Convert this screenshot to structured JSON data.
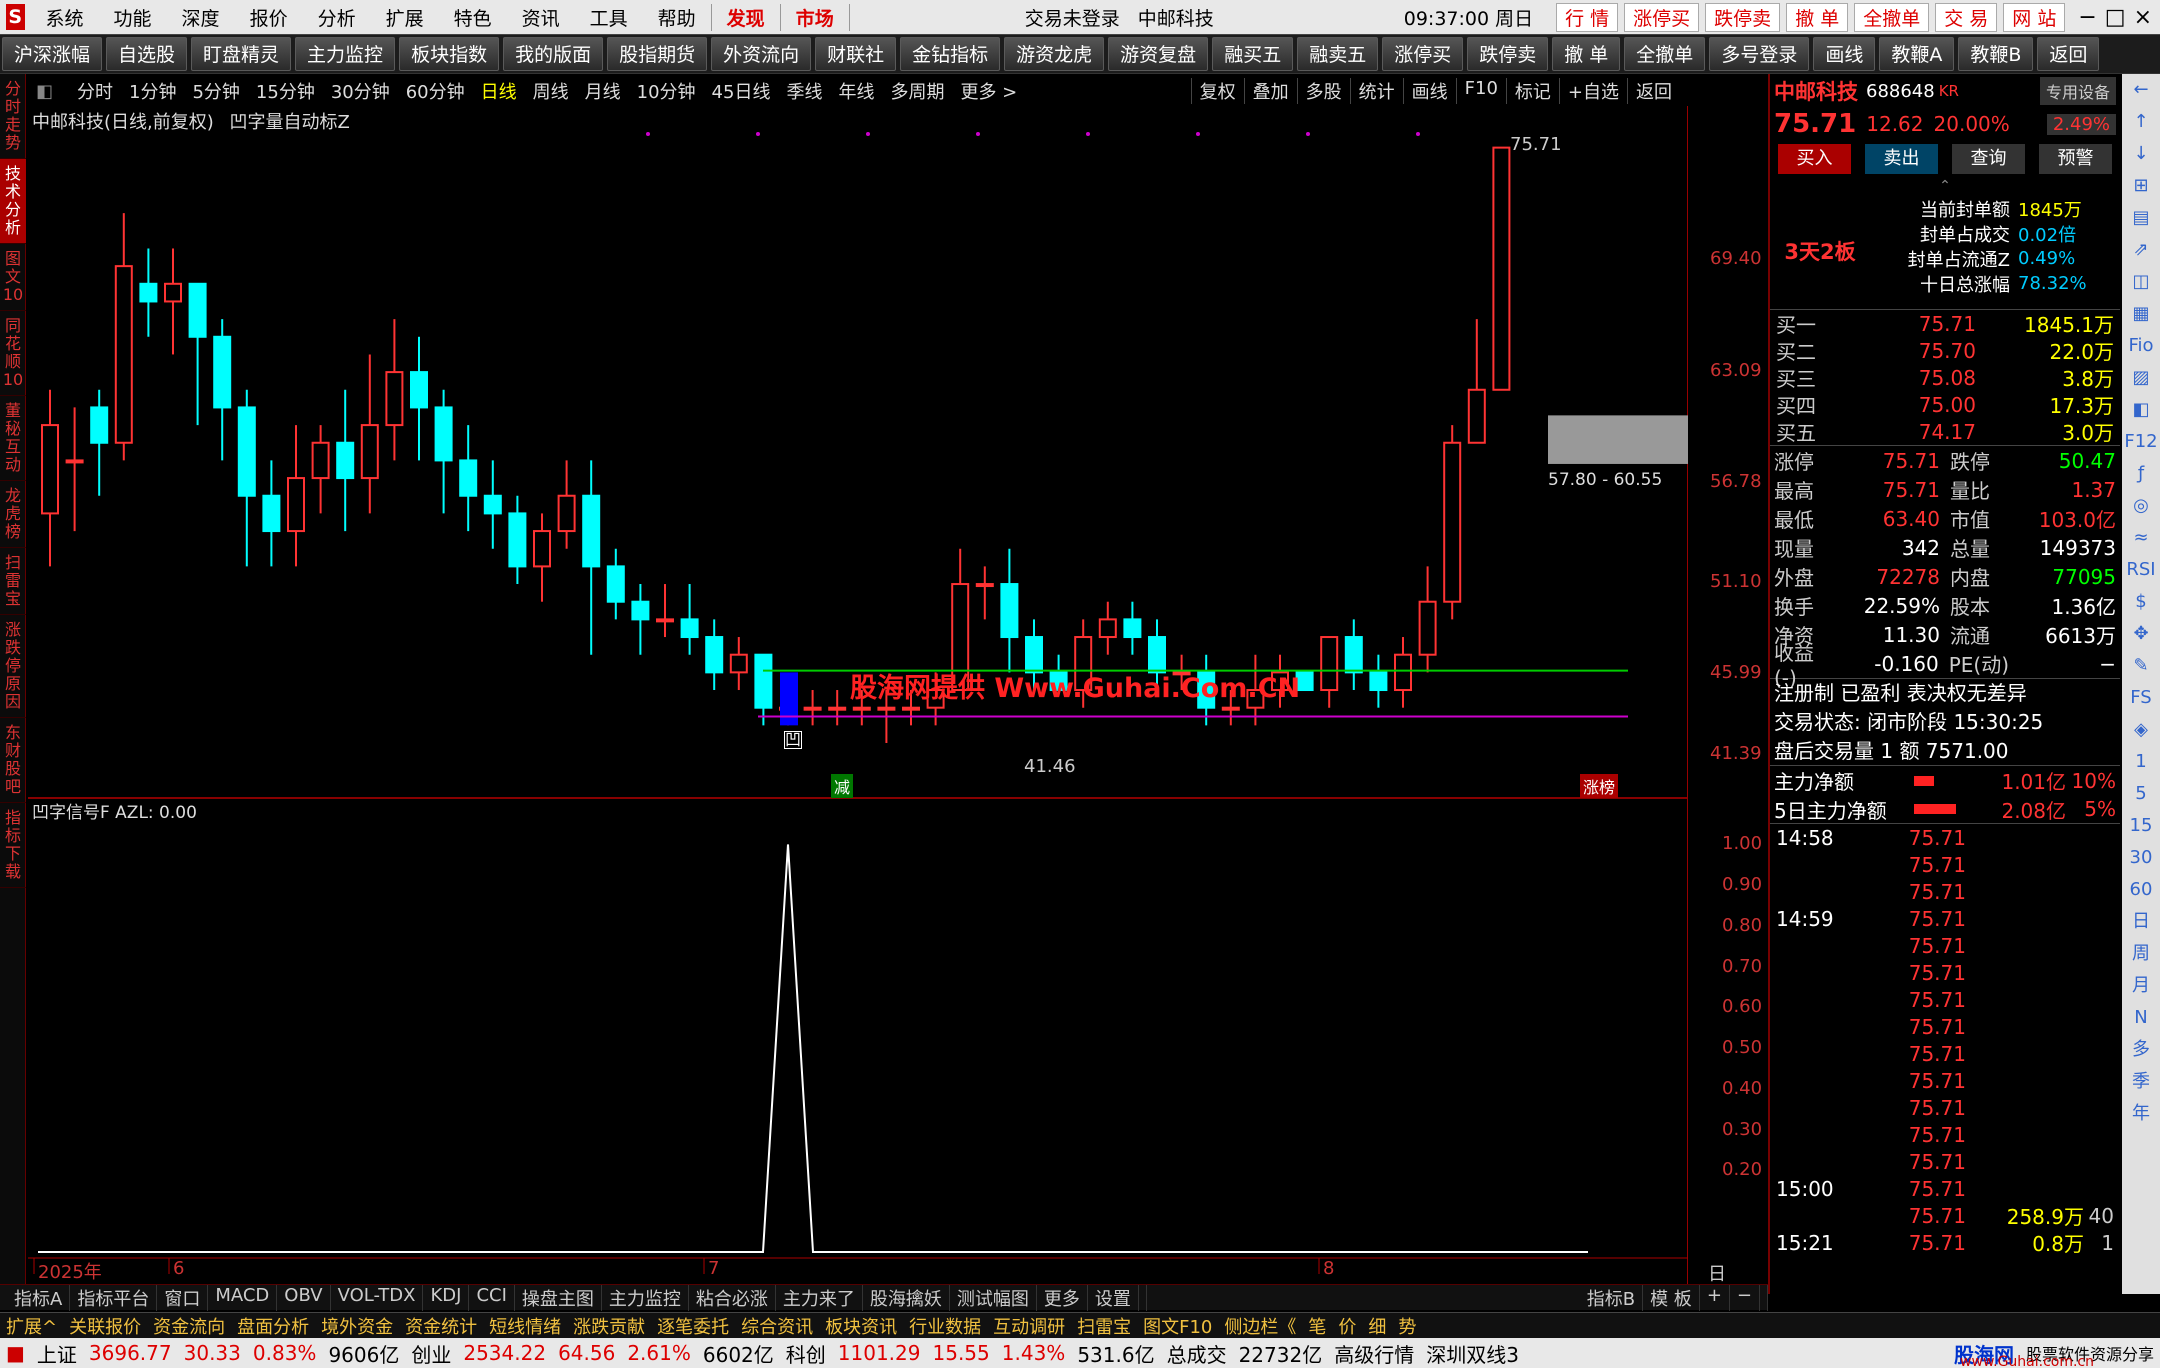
{
  "menu": {
    "items": [
      "系统",
      "功能",
      "深度",
      "报价",
      "分析",
      "扩展",
      "特色",
      "资讯",
      "工具",
      "帮助"
    ],
    "hl1": "发现",
    "hl2": "市场",
    "login": "交易未登录",
    "stock_name": "中邮科技",
    "time": "09:37:00 周日",
    "btns": [
      "行 情",
      "涨停买",
      "跌停卖",
      "撤 单",
      "全撤单",
      "交 易",
      "网 站"
    ]
  },
  "toolbar": [
    "沪深涨幅",
    "自选股",
    "盯盘精灵",
    "主力监控",
    "板块指数",
    "我的版面",
    "股指期货",
    "外资流向",
    "财联社",
    "金钻指标",
    "游资龙虎",
    "游资复盘",
    "融买五",
    "融卖五",
    "涨停买",
    "跌停卖",
    "撤 单",
    "全撤单",
    "多号登录",
    "画线",
    "教鞭A",
    "教鞭B",
    "返回"
  ],
  "periods": [
    "分时",
    "1分钟",
    "5分钟",
    "15分钟",
    "30分钟",
    "60分钟",
    "日线",
    "周线",
    "月线",
    "10分钟",
    "45日线",
    "季线",
    "年线",
    "多周期",
    "更多 >"
  ],
  "period_active": "日线",
  "chart_tools": [
    "复权",
    "叠加",
    "多股",
    "统计",
    "画线",
    "F10",
    "标记",
    "+自选",
    "返回"
  ],
  "leftnav": [
    "分时走势",
    "技术分析",
    "图文10",
    "同花顺10",
    "董秘互动",
    "龙虎榜",
    "扫雷宝",
    "涨跌停原因",
    "东财股吧",
    "指标下载"
  ],
  "leftnav_active": "技术分析",
  "chart": {
    "title": "中邮科技(日线,前复权)",
    "indicator": "凹字量自动标Z",
    "high_label": "75.71",
    "low_label": "41.46",
    "zone_label": "57.80 - 60.55",
    "watermark": "股海网提供 Www.Guhai.Com.CN",
    "badge_jian": "减",
    "badge_zt": "涨榜",
    "ao": "凹",
    "yticks": [
      "69.40",
      "63.09",
      "56.78",
      "51.10",
      "45.99",
      "41.39"
    ]
  },
  "lower": {
    "title": "凹字信号F  AZL: 0.00",
    "yticks": [
      "1.00",
      "0.90",
      "0.80",
      "0.70",
      "0.60",
      "0.50",
      "0.40",
      "0.30",
      "0.20"
    ],
    "xlabels": [
      "2025年",
      "6",
      "7",
      "8"
    ],
    "period": "日线"
  },
  "bottom_tabs": [
    "指标A",
    "指标平台",
    "窗口",
    "MACD",
    "OBV",
    "VOL-TDX",
    "KDJ",
    "CCI",
    "操盘主图",
    "主力监控",
    "粘合必涨",
    "主力来了",
    "股海擒妖",
    "测试幅图",
    "更多",
    "设置"
  ],
  "bottom_right": [
    "指标B",
    "模 板",
    "+",
    "−"
  ],
  "tab2": [
    "扩展^",
    "关联报价",
    "资金流向",
    "盘面分析",
    "境外资金",
    "资金统计",
    "短线情绪",
    "涨跌贡献",
    "逐笔委托",
    "综合资讯",
    "板块资讯",
    "行业数据",
    "互动调研",
    "扫雷宝",
    "图文F10",
    "侧边栏《",
    "笔",
    "价",
    "细",
    "势"
  ],
  "status": {
    "sh_label": "上证",
    "sh": "3696.77",
    "sh_chg": "30.33",
    "sh_pct": "0.83%",
    "sh_amt": "9606亿",
    "cy_label": "创业",
    "cy": "2534.22",
    "cy_chg": "64.56",
    "cy_pct": "2.61%",
    "cy_amt": "6602亿",
    "kc_label": "科创",
    "kc": "1101.29",
    "kc_chg": "15.55",
    "kc_pct": "1.43%",
    "kc_amt": "531.6亿",
    "total": "总成交",
    "total_v": "22732亿",
    "mode": "高级行情",
    "server": "深圳双线3",
    "logo": "股海网",
    "logo_sub": "股票软件资源分享",
    "url": "www.Guhai.com.cn"
  },
  "quote": {
    "name": "中邮科技",
    "code": "688648",
    "tag": "KR",
    "special": "专用设备",
    "price": "75.71",
    "chg": "12.62",
    "pct": "20.00%",
    "pct2": "2.49%",
    "btn_buy": "买入",
    "btn_sell": "卖出",
    "btn_query": "查询",
    "btn_alert": "预警",
    "streak": "3天2板",
    "seal": [
      [
        "当前封单额",
        "1845万"
      ],
      [
        "封单占成交",
        "0.02倍"
      ],
      [
        "封单占流通Z",
        "0.49%"
      ],
      [
        "十日总涨幅",
        "78.32%"
      ]
    ],
    "bids": [
      [
        "买一",
        "75.71",
        "1845.1万"
      ],
      [
        "买二",
        "75.70",
        "22.0万"
      ],
      [
        "买三",
        "75.08",
        "3.8万"
      ],
      [
        "买四",
        "75.00",
        "17.3万"
      ],
      [
        "买五",
        "74.17",
        "3.0万"
      ]
    ],
    "stats": [
      [
        "涨停",
        "75.71",
        "跌停",
        "50.47"
      ],
      [
        "最高",
        "75.71",
        "量比",
        "1.37"
      ],
      [
        "最低",
        "63.40",
        "市值",
        "103.0亿"
      ],
      [
        "现量",
        "342",
        "总量",
        "149373"
      ],
      [
        "外盘",
        "72278",
        "内盘",
        "77095"
      ],
      [
        "换手",
        "22.59%",
        "股本",
        "1.36亿"
      ],
      [
        "净资",
        "11.30",
        "流通",
        "6613万"
      ],
      [
        "收益(-)",
        "-0.160",
        "PE(动)",
        "−"
      ]
    ],
    "reg": "注册制 已盈利 表决权无差异",
    "trade_state": "交易状态: 闭市阶段 15:30:25",
    "after": "盘后交易量 1 额 7571.00",
    "main_net_l": "主力净额",
    "main_net": "1.01亿",
    "main_net_p": "10%",
    "main5_l": "5日主力净额",
    "main5": "2.08亿",
    "main5_p": "5%",
    "ticks": [
      [
        "14:58",
        "75.71",
        "",
        ""
      ],
      [
        "",
        "75.71",
        "",
        ""
      ],
      [
        "",
        "75.71",
        "",
        ""
      ],
      [
        "14:59",
        "75.71",
        "",
        ""
      ],
      [
        "",
        "75.71",
        "",
        ""
      ],
      [
        "",
        "75.71",
        "",
        ""
      ],
      [
        "",
        "75.71",
        "",
        ""
      ],
      [
        "",
        "75.71",
        "",
        ""
      ],
      [
        "",
        "75.71",
        "",
        ""
      ],
      [
        "",
        "75.71",
        "",
        ""
      ],
      [
        "",
        "75.71",
        "",
        ""
      ],
      [
        "",
        "75.71",
        "",
        ""
      ],
      [
        "",
        "75.71",
        "",
        ""
      ],
      [
        "15:00",
        "75.71",
        "",
        ""
      ],
      [
        "",
        "75.71",
        "258.9万",
        "40"
      ],
      [
        "15:21",
        "75.71",
        "0.8万",
        "1"
      ]
    ]
  },
  "iconcol": [
    "←",
    "↑",
    "↓",
    "⊞",
    "▤",
    "⇗",
    "◫",
    "▦",
    "Fio",
    "▨",
    "◧",
    "F12",
    "ƒ",
    "◎",
    "≈",
    "RSI",
    "$",
    "✥",
    "✎",
    "FS",
    "◈",
    "1",
    "5",
    "15",
    "30",
    "60",
    "日",
    "周",
    "月",
    "N",
    "多",
    "季",
    "年"
  ],
  "chart_data": {
    "type": "candlestick",
    "ylim": [
      41.39,
      75.71
    ],
    "candles": [
      [
        55,
        60,
        52,
        62
      ],
      [
        58,
        58,
        54,
        61
      ],
      [
        61,
        59,
        56,
        62
      ],
      [
        59,
        69,
        58,
        72
      ],
      [
        68,
        67,
        65,
        70
      ],
      [
        67,
        68,
        64,
        70
      ],
      [
        68,
        65,
        60,
        68
      ],
      [
        65,
        61,
        58,
        66
      ],
      [
        61,
        56,
        52,
        62
      ],
      [
        56,
        54,
        52,
        58
      ],
      [
        54,
        57,
        52,
        60
      ],
      [
        57,
        59,
        55,
        60
      ],
      [
        59,
        57,
        54,
        62
      ],
      [
        57,
        60,
        55,
        64
      ],
      [
        60,
        63,
        58,
        66
      ],
      [
        63,
        61,
        58,
        65
      ],
      [
        61,
        58,
        55,
        62
      ],
      [
        58,
        56,
        54,
        60
      ],
      [
        56,
        55,
        53,
        58
      ],
      [
        55,
        52,
        51,
        56
      ],
      [
        52,
        54,
        50,
        55
      ],
      [
        54,
        56,
        53,
        58
      ],
      [
        56,
        52,
        47,
        58
      ],
      [
        52,
        50,
        49,
        53
      ],
      [
        50,
        49,
        47,
        51
      ],
      [
        49,
        49,
        48,
        51
      ],
      [
        49,
        48,
        47,
        51
      ],
      [
        48,
        46,
        45,
        49
      ],
      [
        46,
        47,
        45,
        48
      ],
      [
        47,
        44,
        43,
        47
      ],
      [
        44,
        44,
        43,
        45
      ],
      [
        44,
        44,
        43,
        45
      ],
      [
        44,
        44,
        43,
        45
      ],
      [
        44,
        44,
        43,
        45
      ],
      [
        44,
        44,
        42,
        45
      ],
      [
        44,
        44,
        43,
        45
      ],
      [
        44,
        45,
        43,
        46
      ],
      [
        45,
        51,
        45,
        53
      ],
      [
        51,
        51,
        49,
        52
      ],
      [
        51,
        48,
        46,
        53
      ],
      [
        48,
        46,
        45,
        49
      ],
      [
        46,
        45,
        45,
        47
      ],
      [
        45,
        48,
        44,
        49
      ],
      [
        48,
        49,
        47,
        50
      ],
      [
        49,
        48,
        47,
        50
      ],
      [
        48,
        46,
        45,
        49
      ],
      [
        46,
        46,
        45,
        47
      ],
      [
        46,
        44,
        43,
        47
      ],
      [
        44,
        44,
        43,
        45
      ],
      [
        44,
        45,
        43,
        47
      ],
      [
        45,
        46,
        44,
        47
      ],
      [
        46,
        45,
        45,
        46
      ],
      [
        45,
        48,
        44,
        48
      ],
      [
        48,
        46,
        45,
        49
      ],
      [
        46,
        45,
        44,
        47
      ],
      [
        45,
        47,
        44,
        48
      ],
      [
        47,
        50,
        46,
        52
      ],
      [
        50,
        59,
        49,
        60
      ],
      [
        59,
        62,
        60,
        66
      ],
      [
        62,
        75.71,
        63.4,
        75.71
      ]
    ]
  }
}
